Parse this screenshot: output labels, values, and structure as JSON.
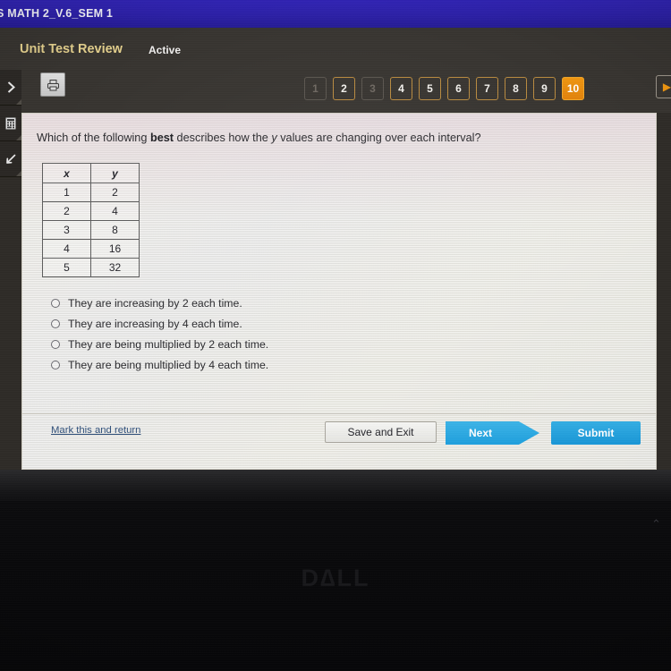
{
  "course_bar": {
    "title": "S MATH 2_V.6_SEM 1"
  },
  "app_header": {
    "assignment_tab": "Unit Test Review",
    "status_tab": "Active",
    "print_icon": "printer-icon"
  },
  "left_toolbar": {
    "items": [
      {
        "name": "expand-panel-icon",
        "glyph": "❯"
      },
      {
        "name": "calculator-icon",
        "glyph": "⌸"
      },
      {
        "name": "pointer-tool-icon",
        "glyph": "↖"
      }
    ]
  },
  "pager": {
    "buttons": [
      {
        "label": "1",
        "state": "disabled"
      },
      {
        "label": "2",
        "state": "available"
      },
      {
        "label": "3",
        "state": "disabled"
      },
      {
        "label": "4",
        "state": "available"
      },
      {
        "label": "5",
        "state": "available"
      },
      {
        "label": "6",
        "state": "available"
      },
      {
        "label": "7",
        "state": "available"
      },
      {
        "label": "8",
        "state": "available"
      },
      {
        "label": "9",
        "state": "available"
      },
      {
        "label": "10",
        "state": "current"
      }
    ],
    "next_page_label": "▶",
    "current_question": "10",
    "accent_color": "#e8890c",
    "border_color": "#b98a3e"
  },
  "question": {
    "prefix": "Which of the following ",
    "emphasis": "best",
    "middle": " describes how the ",
    "variable": "y",
    "suffix": " values are changing over each interval?"
  },
  "table": {
    "headers": [
      "x",
      "y"
    ],
    "rows": [
      [
        "1",
        "2"
      ],
      [
        "2",
        "4"
      ],
      [
        "3",
        "8"
      ],
      [
        "4",
        "16"
      ],
      [
        "5",
        "32"
      ]
    ]
  },
  "options": [
    {
      "label": "They are increasing by 2 each time.",
      "selected": false
    },
    {
      "label": "They are increasing by 4 each time.",
      "selected": false
    },
    {
      "label": "They are being multiplied by 2 each time.",
      "selected": false
    },
    {
      "label": "They are being multiplied by 4 each time.",
      "selected": false
    }
  ],
  "actions": {
    "mark_link": "Mark this and return",
    "save_exit": "Save and Exit",
    "next": "Next",
    "submit": "Submit",
    "button_color": "#1e9fdd"
  },
  "device": {
    "brand": "D∆LL",
    "bezel_chevron": "⌃"
  }
}
